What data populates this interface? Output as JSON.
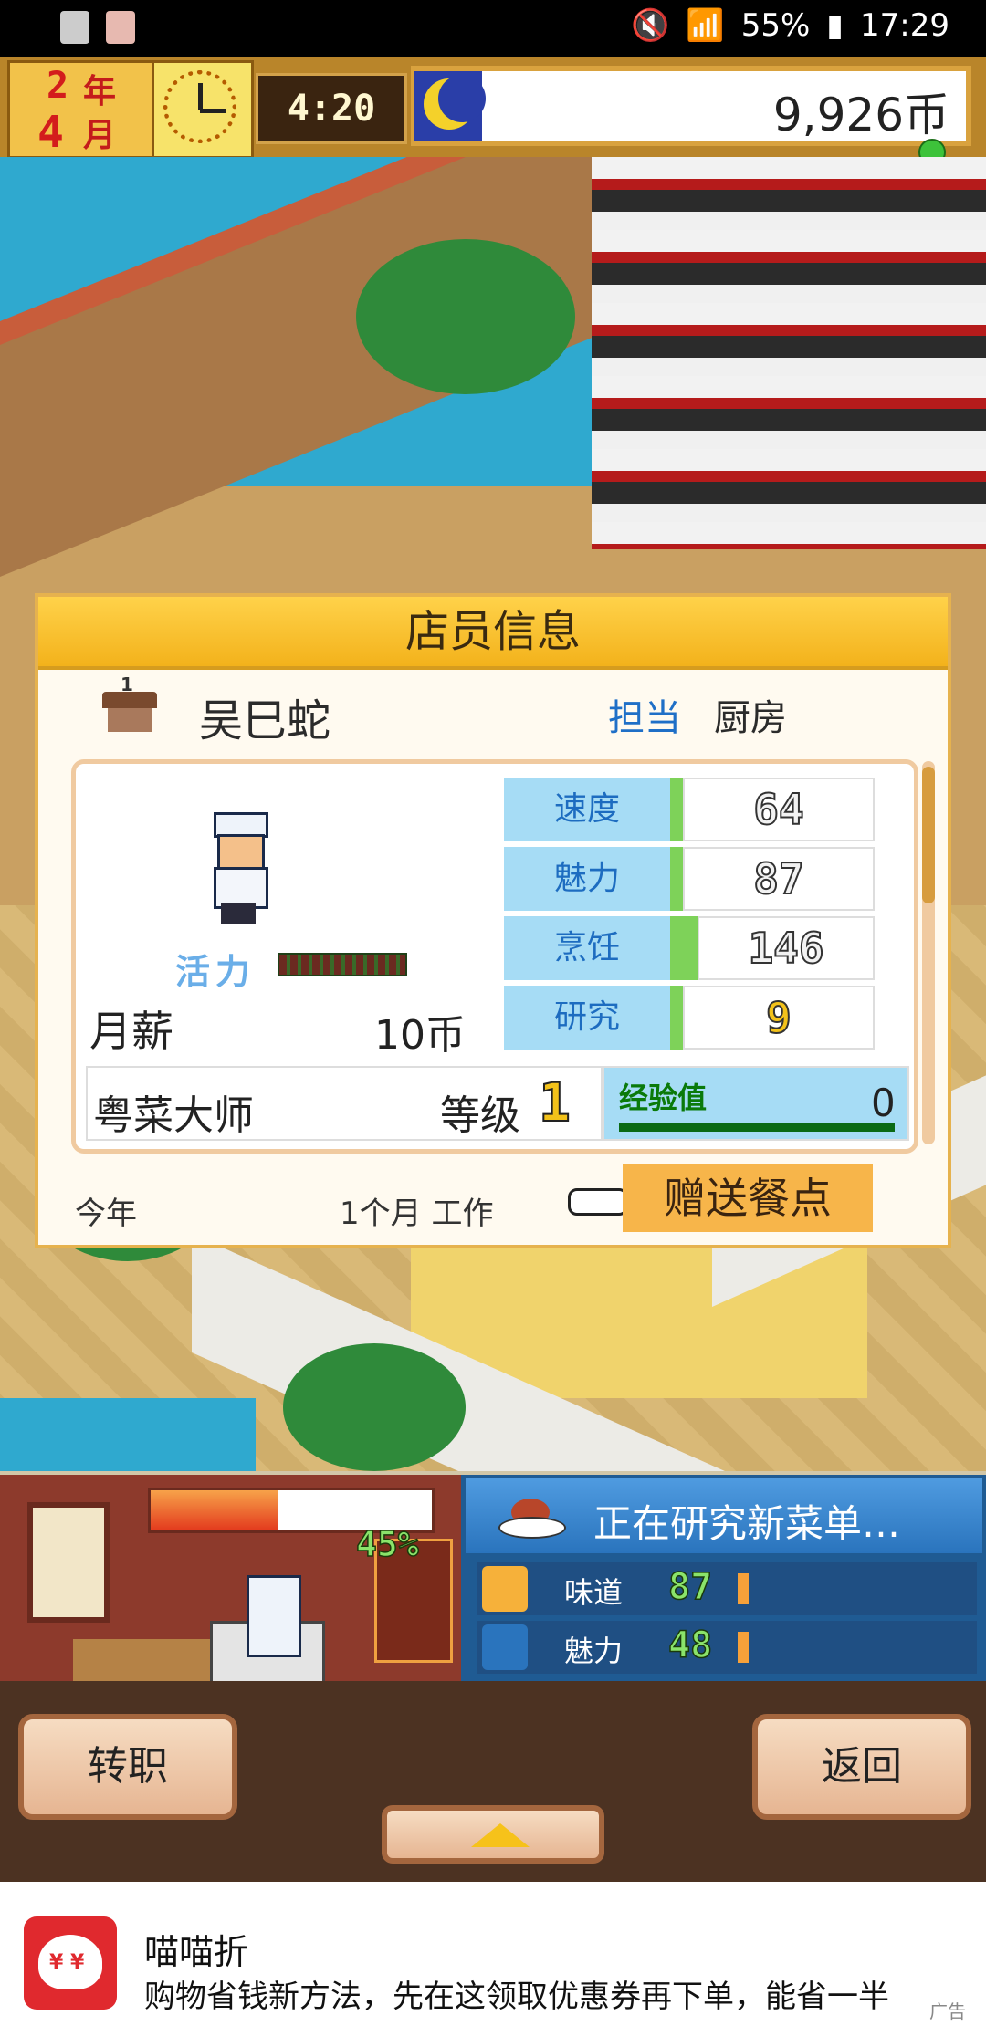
{
  "status_bar": {
    "battery": "55%",
    "time": "17:29"
  },
  "hud": {
    "year_num": "2",
    "year_label": "年",
    "month_num": "4",
    "month_label": "月",
    "time": "4:20",
    "money": "9,926币"
  },
  "dialog": {
    "title": "店员信息",
    "rank_badge": "1",
    "name": "吴巳蛇",
    "dept_label": "担当",
    "dept_value": "厨房",
    "vitality_label": "活力",
    "vitality_level": 1.0,
    "salary_label": "月薪",
    "salary_value": "10币",
    "stats": [
      {
        "name": "速度",
        "value": "64"
      },
      {
        "name": "魅力",
        "value": "87"
      },
      {
        "name": "烹饪",
        "value": "146"
      },
      {
        "name": "研究",
        "value": "9"
      }
    ],
    "rank_title": "粤菜大师",
    "level_label": "等级",
    "level_value": "1",
    "exp_label": "经验值",
    "exp_value": "0",
    "year_label": "今年",
    "work_label": "1个月 工作",
    "gift_button": "赠送餐点"
  },
  "kitchen": {
    "progress_percent": "45%",
    "progress_fraction": 0.45
  },
  "research": {
    "title": "正在研究新菜单…",
    "rows": [
      {
        "label": "味道",
        "value": "87"
      },
      {
        "label": "魅力",
        "value": "48"
      }
    ]
  },
  "buttons": {
    "transfer": "转职",
    "back": "返回"
  },
  "ad": {
    "title": "喵喵折",
    "text": "购物省钱新方法，先在这领取优惠券再下单，能省一半",
    "tag": "广告"
  },
  "colors": {
    "accent_gold": "#f3b21b",
    "stat_blue": "#a6dcf5",
    "research_blue": "#1f5b93"
  }
}
